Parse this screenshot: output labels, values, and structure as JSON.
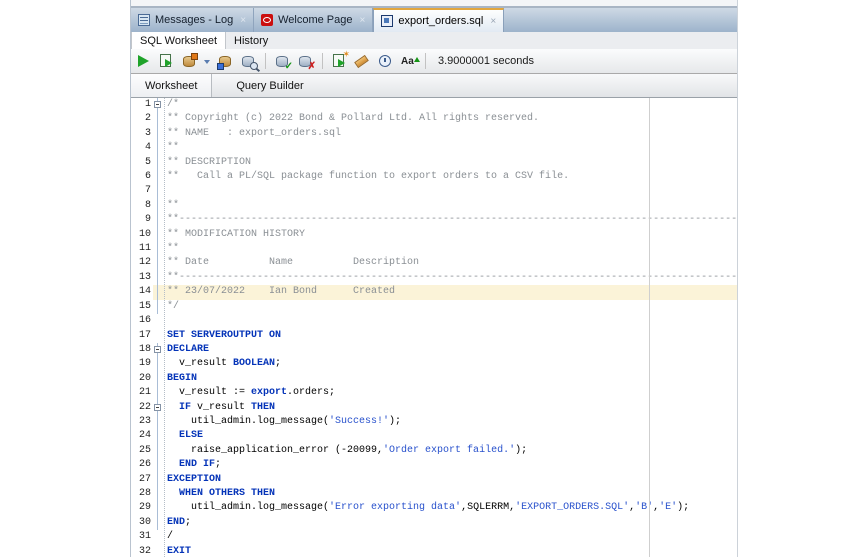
{
  "window": {
    "close_glyph": "×",
    "tabs": [
      {
        "label": "Messages - Log",
        "icon": "messages-log-icon"
      },
      {
        "label": "Welcome Page",
        "icon": "oracle-icon"
      },
      {
        "label": "export_orders.sql",
        "icon": "sql-file-icon",
        "active": true
      }
    ]
  },
  "doc_tabs": {
    "sql_worksheet": "SQL Worksheet",
    "history": "History"
  },
  "toolbar": {
    "icons": [
      "run-statement",
      "run-script",
      "autotrace",
      "autotrace-dropdown",
      "explain-plan",
      "sql-tuning-advisor",
      "commit",
      "rollback",
      "unshared-worksheet",
      "clear",
      "sql-history",
      "change-case"
    ],
    "change_case_glyph": "Aa",
    "unshared_star_glyph": "✶",
    "commit_mark": "✓",
    "rollback_mark": "✗",
    "timer": "3.9000001 seconds"
  },
  "view_tabs": {
    "worksheet": "Worksheet",
    "query_builder": "Query Builder"
  },
  "editor": {
    "colors": {
      "keyword": "#0433b8",
      "string": "#2851cc",
      "comment": "#8a8f94",
      "plain": "#000000",
      "current_line_bg": "#fbf3d8",
      "margin_line": "#cfcfcf",
      "tabbar_bg": "#9db3cb",
      "active_tab_stripe": "#e2a63e"
    },
    "current_line": 14,
    "lines": [
      {
        "n": 1,
        "fold": true,
        "scope": true,
        "seg": [
          [
            "c",
            "/*"
          ]
        ]
      },
      {
        "n": 2,
        "scope": true,
        "seg": [
          [
            "c",
            "** Copyright (c) 2022 Bond & Pollard Ltd. All rights reserved."
          ]
        ]
      },
      {
        "n": 3,
        "scope": true,
        "seg": [
          [
            "c",
            "** NAME   : export_orders.sql"
          ]
        ]
      },
      {
        "n": 4,
        "scope": true,
        "seg": [
          [
            "c",
            "**"
          ]
        ]
      },
      {
        "n": 5,
        "scope": true,
        "seg": [
          [
            "c",
            "** DESCRIPTION"
          ]
        ]
      },
      {
        "n": 6,
        "scope": true,
        "seg": [
          [
            "c",
            "**   Call a PL/SQL package function to export orders to a CSV file."
          ]
        ]
      },
      {
        "n": 7,
        "scope": true,
        "seg": []
      },
      {
        "n": 8,
        "scope": true,
        "seg": [
          [
            "c",
            "**"
          ]
        ]
      },
      {
        "n": 9,
        "scope": true,
        "seg": [
          [
            "c",
            "**----------------------------------------------------------------------------------------------------"
          ]
        ]
      },
      {
        "n": 10,
        "scope": true,
        "seg": [
          [
            "c",
            "** MODIFICATION HISTORY"
          ]
        ]
      },
      {
        "n": 11,
        "scope": true,
        "seg": [
          [
            "c",
            "**"
          ]
        ]
      },
      {
        "n": 12,
        "scope": true,
        "seg": [
          [
            "c",
            "** Date          Name          Description"
          ]
        ]
      },
      {
        "n": 13,
        "scope": true,
        "seg": [
          [
            "c",
            "**----------------------------------------------------------------------------------------------------"
          ]
        ]
      },
      {
        "n": 14,
        "scope": true,
        "seg": [
          [
            "c",
            "** 23/07/2022    Ian Bond      Created"
          ]
        ]
      },
      {
        "n": 15,
        "scope": true,
        "seg": [
          [
            "c",
            "*/"
          ]
        ]
      },
      {
        "n": 16,
        "seg": []
      },
      {
        "n": 17,
        "seg": [
          [
            "k",
            "SET SERVEROUTPUT ON"
          ]
        ]
      },
      {
        "n": 18,
        "fold": true,
        "scope": true,
        "seg": [
          [
            "k",
            "DECLARE"
          ]
        ]
      },
      {
        "n": 19,
        "scope": true,
        "seg": [
          [
            "p",
            "  v_result "
          ],
          [
            "k",
            "BOOLEAN"
          ],
          [
            "p",
            ";"
          ]
        ]
      },
      {
        "n": 20,
        "scope": true,
        "seg": [
          [
            "k",
            "BEGIN"
          ]
        ]
      },
      {
        "n": 21,
        "scope": true,
        "seg": [
          [
            "p",
            "  v_result := "
          ],
          [
            "k",
            "export"
          ],
          [
            "p",
            ".orders;"
          ]
        ]
      },
      {
        "n": 22,
        "fold": true,
        "scope": true,
        "seg": [
          [
            "p",
            "  "
          ],
          [
            "k",
            "IF"
          ],
          [
            "p",
            " v_result "
          ],
          [
            "k",
            "THEN"
          ]
        ]
      },
      {
        "n": 23,
        "scope": true,
        "seg": [
          [
            "p",
            "    util_admin.log_message("
          ],
          [
            "s",
            "'Success!'"
          ],
          [
            "p",
            ");"
          ]
        ]
      },
      {
        "n": 24,
        "scope": true,
        "seg": [
          [
            "p",
            "  "
          ],
          [
            "k",
            "ELSE"
          ]
        ]
      },
      {
        "n": 25,
        "scope": true,
        "seg": [
          [
            "p",
            "    raise_application_error (-20099,"
          ],
          [
            "s",
            "'Order export failed.'"
          ],
          [
            "p",
            ");"
          ]
        ]
      },
      {
        "n": 26,
        "scope": true,
        "seg": [
          [
            "p",
            "  "
          ],
          [
            "k",
            "END IF"
          ],
          [
            "p",
            ";"
          ]
        ]
      },
      {
        "n": 27,
        "scope": true,
        "seg": [
          [
            "k",
            "EXCEPTION"
          ]
        ]
      },
      {
        "n": 28,
        "scope": true,
        "seg": [
          [
            "p",
            "  "
          ],
          [
            "k",
            "WHEN OTHERS THEN"
          ]
        ]
      },
      {
        "n": 29,
        "scope": true,
        "seg": [
          [
            "p",
            "    util_admin.log_message("
          ],
          [
            "s",
            "'Error exporting data'"
          ],
          [
            "p",
            ",SQLERRM,"
          ],
          [
            "s",
            "'EXPORT_ORDERS.SQL'"
          ],
          [
            "p",
            ","
          ],
          [
            "s",
            "'B'"
          ],
          [
            "p",
            ","
          ],
          [
            "s",
            "'E'"
          ],
          [
            "p",
            ");"
          ]
        ]
      },
      {
        "n": 30,
        "scope": true,
        "seg": [
          [
            "k",
            "END"
          ],
          [
            "p",
            ";"
          ]
        ]
      },
      {
        "n": 31,
        "seg": [
          [
            "p",
            "/"
          ]
        ]
      },
      {
        "n": 32,
        "seg": [
          [
            "k",
            "EXIT"
          ]
        ]
      }
    ]
  }
}
